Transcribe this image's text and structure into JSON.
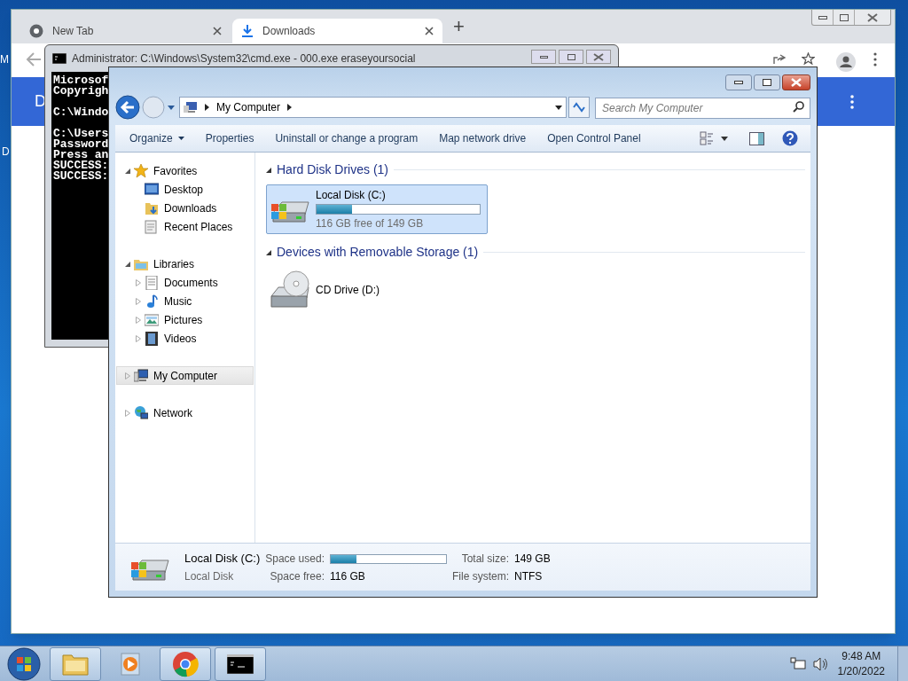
{
  "desktop": {
    "icon_labels": [
      "M",
      "D"
    ]
  },
  "browser": {
    "tabs": [
      {
        "label": "New Tab",
        "kind": "newtab",
        "selected": false
      },
      {
        "label": "Downloads",
        "kind": "downloads",
        "selected": true
      }
    ],
    "new_tab": "+",
    "banner_text": "D"
  },
  "console": {
    "title": "Administrator: C:\\Windows\\System32\\cmd.exe - 000.exe  eraseyoursocial",
    "paragraphs": [
      [
        "Microsof",
        "Copyrigh"
      ],
      [
        "C:\\Windo"
      ],
      [
        "C:\\Users",
        "Password",
        "Press an",
        "SUCCESS:",
        "SUCCESS:"
      ]
    ]
  },
  "explorer": {
    "breadcrumb": [
      "My Computer"
    ],
    "search": {
      "placeholder": "Search My Computer"
    },
    "commands": [
      {
        "label": "Organize",
        "dropdown": true
      },
      {
        "label": "Properties",
        "dropdown": false
      },
      {
        "label": "Uninstall or change a program",
        "dropdown": false
      },
      {
        "label": "Map network drive",
        "dropdown": false
      },
      {
        "label": "Open Control Panel",
        "dropdown": false
      }
    ],
    "nav": [
      {
        "label": "Favorites",
        "kind": "star",
        "expanded": true,
        "selected": false,
        "children": [
          {
            "label": "Desktop",
            "kind": "desktop",
            "selected": false
          },
          {
            "label": "Downloads",
            "kind": "downloads",
            "selected": false
          },
          {
            "label": "Recent Places",
            "kind": "recent",
            "selected": false
          }
        ]
      },
      {
        "label": "Libraries",
        "kind": "libraries",
        "expanded": true,
        "selected": false,
        "children": [
          {
            "label": "Documents",
            "kind": "documents",
            "expanded": false,
            "selected": false
          },
          {
            "label": "Music",
            "kind": "music",
            "expanded": false,
            "selected": false
          },
          {
            "label": "Pictures",
            "kind": "pictures",
            "expanded": false,
            "selected": false
          },
          {
            "label": "Videos",
            "kind": "videos",
            "expanded": false,
            "selected": false
          }
        ]
      },
      {
        "label": "My Computer",
        "kind": "computer",
        "expanded": false,
        "selected": true
      },
      {
        "label": "Network",
        "kind": "network",
        "expanded": false,
        "selected": false
      }
    ],
    "groups": [
      {
        "title": "Hard Disk Drives (1)",
        "items": [
          {
            "name": "Local Disk (C:)",
            "kind": "disk",
            "selected": true,
            "level": 0.22,
            "info": "116 GB free of 149 GB"
          }
        ]
      },
      {
        "title": "Devices with Removable Storage (1)",
        "items": [
          {
            "name": "CD Drive (D:)",
            "kind": "cd",
            "selected": false
          }
        ]
      }
    ],
    "details": {
      "name": "Local Disk (C:)",
      "type": "Local Disk",
      "used_label": "Space used:",
      "level": 0.22,
      "free_label": "Space free:",
      "free": "116 GB",
      "total_label": "Total size:",
      "total": "149 GB",
      "fs_label": "File system:",
      "fs": "NTFS"
    }
  },
  "taskbar": {
    "apps": [
      {
        "kind": "explorer",
        "running": true
      },
      {
        "kind": "media",
        "running": false
      },
      {
        "kind": "chrome",
        "running": true
      },
      {
        "kind": "console",
        "running": true
      }
    ],
    "time": "9:48 AM",
    "date": "1/20/2022"
  }
}
